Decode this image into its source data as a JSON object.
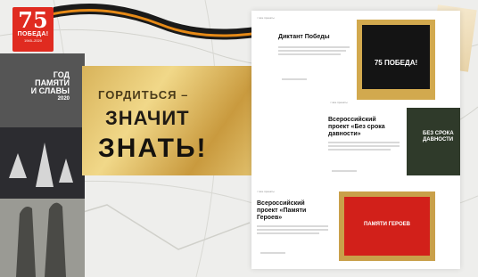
{
  "logo": {
    "number": "75",
    "word": "ПОБЕДА!",
    "years": "1945–2020"
  },
  "year_block": {
    "line1": "ГОД",
    "line2": "ПАМЯТИ",
    "line3": "И СЛАВЫ",
    "line4": "2020"
  },
  "banner": {
    "slogan_line1": "ГОРДИТЬСЯ –",
    "slogan_line2": "ЗНАЧИТ",
    "slogan_line3": "ЗНАТЬ!"
  },
  "cards": [
    {
      "crumb": "< все проекты",
      "title": "Диктант Победы",
      "thumb_caption": "75 ПОБЕДА!"
    },
    {
      "crumb": "< все проекты",
      "title_line1": "Всероссийский",
      "title_line2": "проект «Без срока",
      "title_line3": "давности»",
      "thumb_caption": "БЕЗ СРОКА ДАВНОСТИ"
    },
    {
      "crumb": "< все проекты",
      "title_line1": "Всероссийский",
      "title_line2": "проект «Памяти",
      "title_line3": "Героев»",
      "thumb_caption": "ПАМЯТИ ГЕРОЕВ"
    }
  ],
  "colors": {
    "brand_red": "#e02b20",
    "gold": "#d8b35a",
    "dark_green": "#2f3a2a"
  }
}
